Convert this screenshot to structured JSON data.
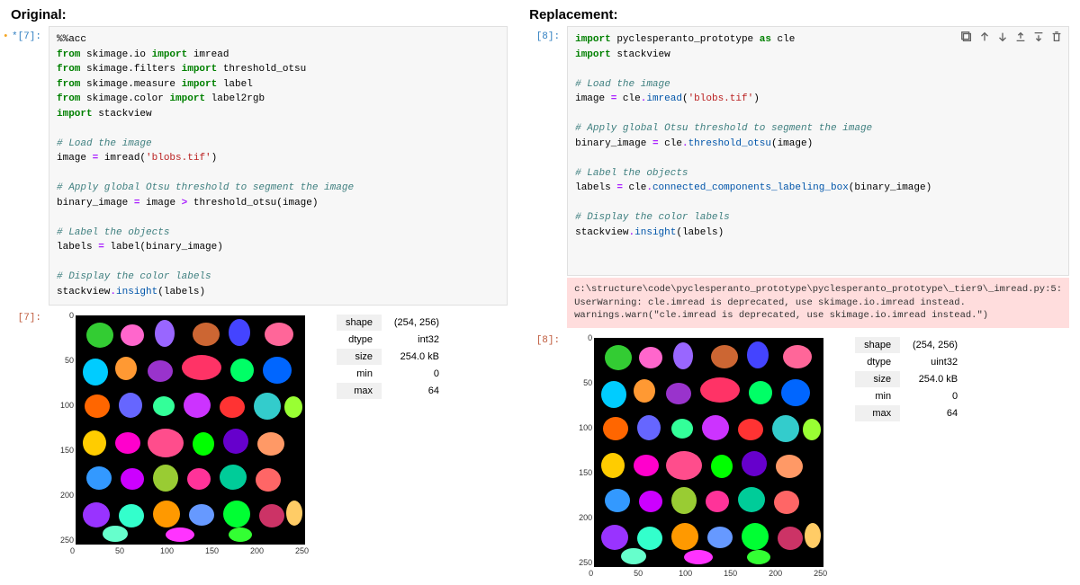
{
  "left": {
    "heading": "Original:",
    "prompt_in": "*[7]:",
    "prompt_out": "[7]:",
    "code_lines": [
      {
        "t": "mag",
        "txt": "%%acc"
      },
      {
        "html": "<span class='kw'>from</span> skimage.io <span class='kw'>import</span> imread"
      },
      {
        "html": "<span class='kw'>from</span> skimage.filters <span class='kw'>import</span> threshold_otsu"
      },
      {
        "html": "<span class='kw'>from</span> skimage.measure <span class='kw'>import</span> label"
      },
      {
        "html": "<span class='kw'>from</span> skimage.color <span class='kw'>import</span> label2rgb"
      },
      {
        "html": "<span class='kw'>import</span> stackview"
      },
      {
        "html": ""
      },
      {
        "html": "<span class='com'># Load the image</span>"
      },
      {
        "html": "image <span class='op'>=</span> imread(<span class='str'>'blobs.tif'</span>)"
      },
      {
        "html": ""
      },
      {
        "html": "<span class='com'># Apply global Otsu threshold to segment the image</span>"
      },
      {
        "html": "binary_image <span class='op'>=</span> image <span class='op'>&gt;</span> threshold_otsu(image)"
      },
      {
        "html": ""
      },
      {
        "html": "<span class='com'># Label the objects</span>"
      },
      {
        "html": "labels <span class='op'>=</span> label(binary_image)"
      },
      {
        "html": ""
      },
      {
        "html": "<span class='com'># Display the color labels</span>"
      },
      {
        "html": "stackview<span class='op'>.</span><span class='fn'>insight</span>(labels)"
      }
    ],
    "info": {
      "shape": "(254, 256)",
      "dtype": "int32",
      "size": "254.0 kB",
      "min": "0",
      "max": "64"
    }
  },
  "right": {
    "heading": "Replacement:",
    "prompt_in": "[8]:",
    "prompt_out": "[8]:",
    "code_lines": [
      {
        "html": "<span class='kw'>import</span> pyclesperanto_prototype <span class='kw'>as</span> cle"
      },
      {
        "html": "<span class='kw'>import</span> stackview"
      },
      {
        "html": ""
      },
      {
        "html": "<span class='com'># Load the image</span>"
      },
      {
        "html": "image <span class='op'>=</span> cle<span class='op'>.</span><span class='fn'>imread</span>(<span class='str'>'blobs.tif'</span>)"
      },
      {
        "html": ""
      },
      {
        "html": "<span class='com'># Apply global Otsu threshold to segment the image</span>"
      },
      {
        "html": "binary_image <span class='op'>=</span> cle<span class='op'>.</span><span class='fn'>threshold_otsu</span>(image)"
      },
      {
        "html": ""
      },
      {
        "html": "<span class='com'># Label the objects</span>"
      },
      {
        "html": "labels <span class='op'>=</span> cle<span class='op'>.</span><span class='fn'>connected_components_labeling_box</span>(binary_image)"
      },
      {
        "html": ""
      },
      {
        "html": "<span class='com'># Display the color labels</span>"
      },
      {
        "html": "stackview<span class='op'>.</span><span class='fn'>insight</span>(labels)"
      }
    ],
    "warning": "c:\\structure\\code\\pyclesperanto_prototype\\pyclesperanto_prototype\\_tier9\\_imread.py:5: UserWarning: cle.imread is deprecated, use skimage.io.imread instead.\n  warnings.warn(\"cle.imread is deprecated, use skimage.io.imread instead.\")",
    "info": {
      "shape": "(254, 256)",
      "dtype": "uint32",
      "size": "254.0 kB",
      "min": "0",
      "max": "64"
    }
  },
  "info_labels": {
    "shape": "shape",
    "dtype": "dtype",
    "size": "size",
    "min": "min",
    "max": "max"
  },
  "chart_data": {
    "type": "segmentation_image",
    "note": "Label map of blob segmentation (~64 labeled blobs), axes 0-250 on both x and y, black background with multicolored blobs.",
    "xlim": [
      0,
      256
    ],
    "ylim": [
      254,
      0
    ],
    "xticks": [
      0,
      50,
      100,
      150,
      200,
      250
    ],
    "yticks": [
      0,
      50,
      100,
      150,
      200,
      250
    ],
    "blobs": [
      {
        "x": 12,
        "y": 8,
        "w": 30,
        "h": 28,
        "c": "#33cc33"
      },
      {
        "x": 50,
        "y": 10,
        "w": 26,
        "h": 24,
        "c": "#ff66cc"
      },
      {
        "x": 88,
        "y": 5,
        "w": 22,
        "h": 30,
        "c": "#9966ff"
      },
      {
        "x": 130,
        "y": 8,
        "w": 30,
        "h": 26,
        "c": "#cc6633"
      },
      {
        "x": 170,
        "y": 4,
        "w": 24,
        "h": 30,
        "c": "#4444ff"
      },
      {
        "x": 210,
        "y": 8,
        "w": 32,
        "h": 26,
        "c": "#ff6699"
      },
      {
        "x": 8,
        "y": 48,
        "w": 28,
        "h": 30,
        "c": "#00ccff"
      },
      {
        "x": 44,
        "y": 46,
        "w": 24,
        "h": 26,
        "c": "#ff9933"
      },
      {
        "x": 80,
        "y": 50,
        "w": 28,
        "h": 24,
        "c": "#9933cc"
      },
      {
        "x": 118,
        "y": 44,
        "w": 44,
        "h": 28,
        "c": "#ff3366"
      },
      {
        "x": 172,
        "y": 48,
        "w": 26,
        "h": 26,
        "c": "#00ff66"
      },
      {
        "x": 208,
        "y": 46,
        "w": 32,
        "h": 30,
        "c": "#0066ff"
      },
      {
        "x": 10,
        "y": 88,
        "w": 28,
        "h": 26,
        "c": "#ff6600"
      },
      {
        "x": 48,
        "y": 86,
        "w": 26,
        "h": 28,
        "c": "#6666ff"
      },
      {
        "x": 86,
        "y": 90,
        "w": 24,
        "h": 22,
        "c": "#33ff99"
      },
      {
        "x": 120,
        "y": 86,
        "w": 30,
        "h": 28,
        "c": "#cc33ff"
      },
      {
        "x": 160,
        "y": 90,
        "w": 28,
        "h": 24,
        "c": "#ff3333"
      },
      {
        "x": 198,
        "y": 86,
        "w": 30,
        "h": 30,
        "c": "#33cccc"
      },
      {
        "x": 232,
        "y": 90,
        "w": 20,
        "h": 24,
        "c": "#99ff33"
      },
      {
        "x": 8,
        "y": 128,
        "w": 26,
        "h": 28,
        "c": "#ffcc00"
      },
      {
        "x": 44,
        "y": 130,
        "w": 28,
        "h": 24,
        "c": "#ff00cc"
      },
      {
        "x": 80,
        "y": 126,
        "w": 40,
        "h": 32,
        "c": "#ff4d8c"
      },
      {
        "x": 130,
        "y": 130,
        "w": 24,
        "h": 26,
        "c": "#00ff00"
      },
      {
        "x": 164,
        "y": 126,
        "w": 28,
        "h": 28,
        "c": "#6600cc"
      },
      {
        "x": 202,
        "y": 130,
        "w": 30,
        "h": 26,
        "c": "#ff9966"
      },
      {
        "x": 12,
        "y": 168,
        "w": 28,
        "h": 26,
        "c": "#3399ff"
      },
      {
        "x": 50,
        "y": 170,
        "w": 26,
        "h": 24,
        "c": "#cc00ff"
      },
      {
        "x": 86,
        "y": 166,
        "w": 28,
        "h": 30,
        "c": "#99cc33"
      },
      {
        "x": 124,
        "y": 170,
        "w": 26,
        "h": 24,
        "c": "#ff3399"
      },
      {
        "x": 160,
        "y": 166,
        "w": 30,
        "h": 28,
        "c": "#00cc99"
      },
      {
        "x": 200,
        "y": 170,
        "w": 28,
        "h": 26,
        "c": "#ff6666"
      },
      {
        "x": 8,
        "y": 208,
        "w": 30,
        "h": 28,
        "c": "#9933ff"
      },
      {
        "x": 48,
        "y": 210,
        "w": 28,
        "h": 26,
        "c": "#33ffcc"
      },
      {
        "x": 86,
        "y": 206,
        "w": 30,
        "h": 30,
        "c": "#ff9900"
      },
      {
        "x": 126,
        "y": 210,
        "w": 28,
        "h": 24,
        "c": "#6699ff"
      },
      {
        "x": 164,
        "y": 206,
        "w": 30,
        "h": 30,
        "c": "#00ff33"
      },
      {
        "x": 204,
        "y": 210,
        "w": 28,
        "h": 26,
        "c": "#cc3366"
      },
      {
        "x": 234,
        "y": 206,
        "w": 18,
        "h": 28,
        "c": "#ffcc66"
      },
      {
        "x": 30,
        "y": 234,
        "w": 28,
        "h": 18,
        "c": "#66ffcc"
      },
      {
        "x": 100,
        "y": 236,
        "w": 32,
        "h": 16,
        "c": "#ff33ff"
      },
      {
        "x": 170,
        "y": 236,
        "w": 26,
        "h": 16,
        "c": "#33ff33"
      }
    ]
  }
}
